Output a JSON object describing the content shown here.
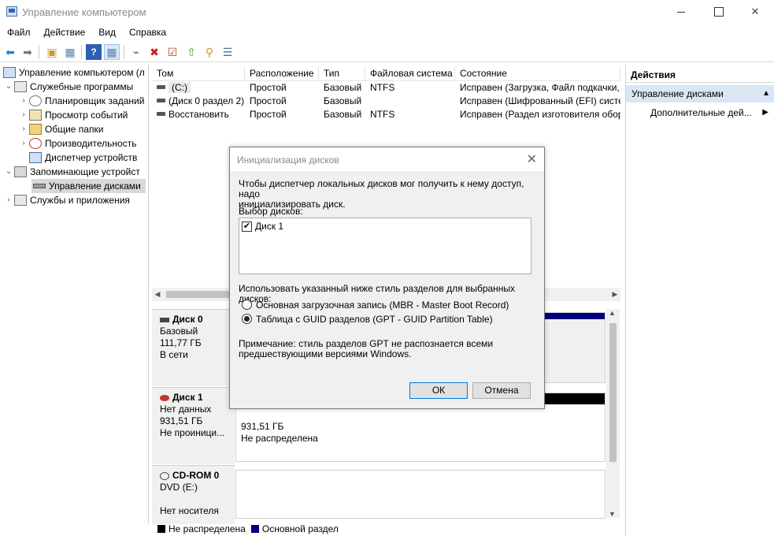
{
  "window": {
    "title": "Управление компьютером"
  },
  "menu": [
    "Файл",
    "Действие",
    "Вид",
    "Справка"
  ],
  "tree": {
    "root": "Управление компьютером (л",
    "items": [
      {
        "label": "Служебные программы",
        "level": 1,
        "arrow": "⌄",
        "icon": "tools-icon"
      },
      {
        "label": "Планировщик заданий",
        "level": 2,
        "arrow": "›",
        "icon": "clock-icon"
      },
      {
        "label": "Просмотр событий",
        "level": 2,
        "arrow": "›",
        "icon": "event-viewer-icon"
      },
      {
        "label": "Общие папки",
        "level": 2,
        "arrow": "›",
        "icon": "shared-folder-icon"
      },
      {
        "label": "Производительность",
        "level": 2,
        "arrow": "›",
        "icon": "performance-icon"
      },
      {
        "label": "Диспетчер устройств",
        "level": 2,
        "arrow": "",
        "icon": "device-manager-icon"
      },
      {
        "label": "Запоминающие устройст",
        "level": 1,
        "arrow": "⌄",
        "icon": "storage-icon"
      },
      {
        "label": "Управление дисками",
        "level": 2,
        "arrow": "",
        "icon": "disk-management-icon",
        "selected": true
      },
      {
        "label": "Службы и приложения",
        "level": 1,
        "arrow": "›",
        "icon": "services-icon"
      }
    ]
  },
  "volumes": {
    "columns": [
      "Том",
      "Расположение",
      "Тип",
      "Файловая система",
      "Состояние"
    ],
    "rows": [
      [
        "(C:)",
        "Простой",
        "Базовый",
        "NTFS",
        "Исправен (Загрузка, Файл подкачки,"
      ],
      [
        "(Диск 0 раздел 2)",
        "Простой",
        "Базовый",
        "",
        "Исправен (Шифрованный (EFI) систе"
      ],
      [
        "Восстановить",
        "Простой",
        "Базовый",
        "NTFS",
        "Исправен (Раздел изготовителя обор"
      ]
    ]
  },
  "disks": [
    {
      "name": "Диск 0",
      "lines": [
        "Базовый",
        "111,77 ГБ",
        "В сети"
      ]
    },
    {
      "name": "Диск 1",
      "lines": [
        "Нет данных",
        "931,51 ГБ",
        "Не проиници..."
      ],
      "area": [
        "931,51 ГБ",
        "Не распределена"
      ]
    },
    {
      "name": "CD-ROM 0",
      "lines": [
        "DVD (E:)",
        "",
        "Нет носителя"
      ]
    }
  ],
  "legend": [
    {
      "label": "Не распределена",
      "color": "#000000"
    },
    {
      "label": "Основной раздел",
      "color": "#00007f"
    }
  ],
  "actions": {
    "header": "Действия",
    "section": "Управление дисками",
    "item": "Дополнительные дей..."
  },
  "dialog": {
    "title": "Инициализация дисков",
    "intro": [
      "Чтобы диспетчер локальных дисков мог получить к нему доступ, надо",
      "инициализировать диск."
    ],
    "select_label": "Выбор дисков:",
    "disk_item": "Диск 1",
    "style_label": "Использовать указанный ниже стиль разделов для выбранных дисков:",
    "option_mbr": "Основная загрузочная запись (MBR - Master Boot Record)",
    "option_gpt": "Таблица с GUID разделов (GPT - GUID Partition Table)",
    "note": [
      "Примечание: стиль разделов GPT не распознается всеми",
      "предшествующими версиями Windows."
    ],
    "ok": "ОК",
    "cancel": "Отмена",
    "selected_option": "gpt"
  }
}
